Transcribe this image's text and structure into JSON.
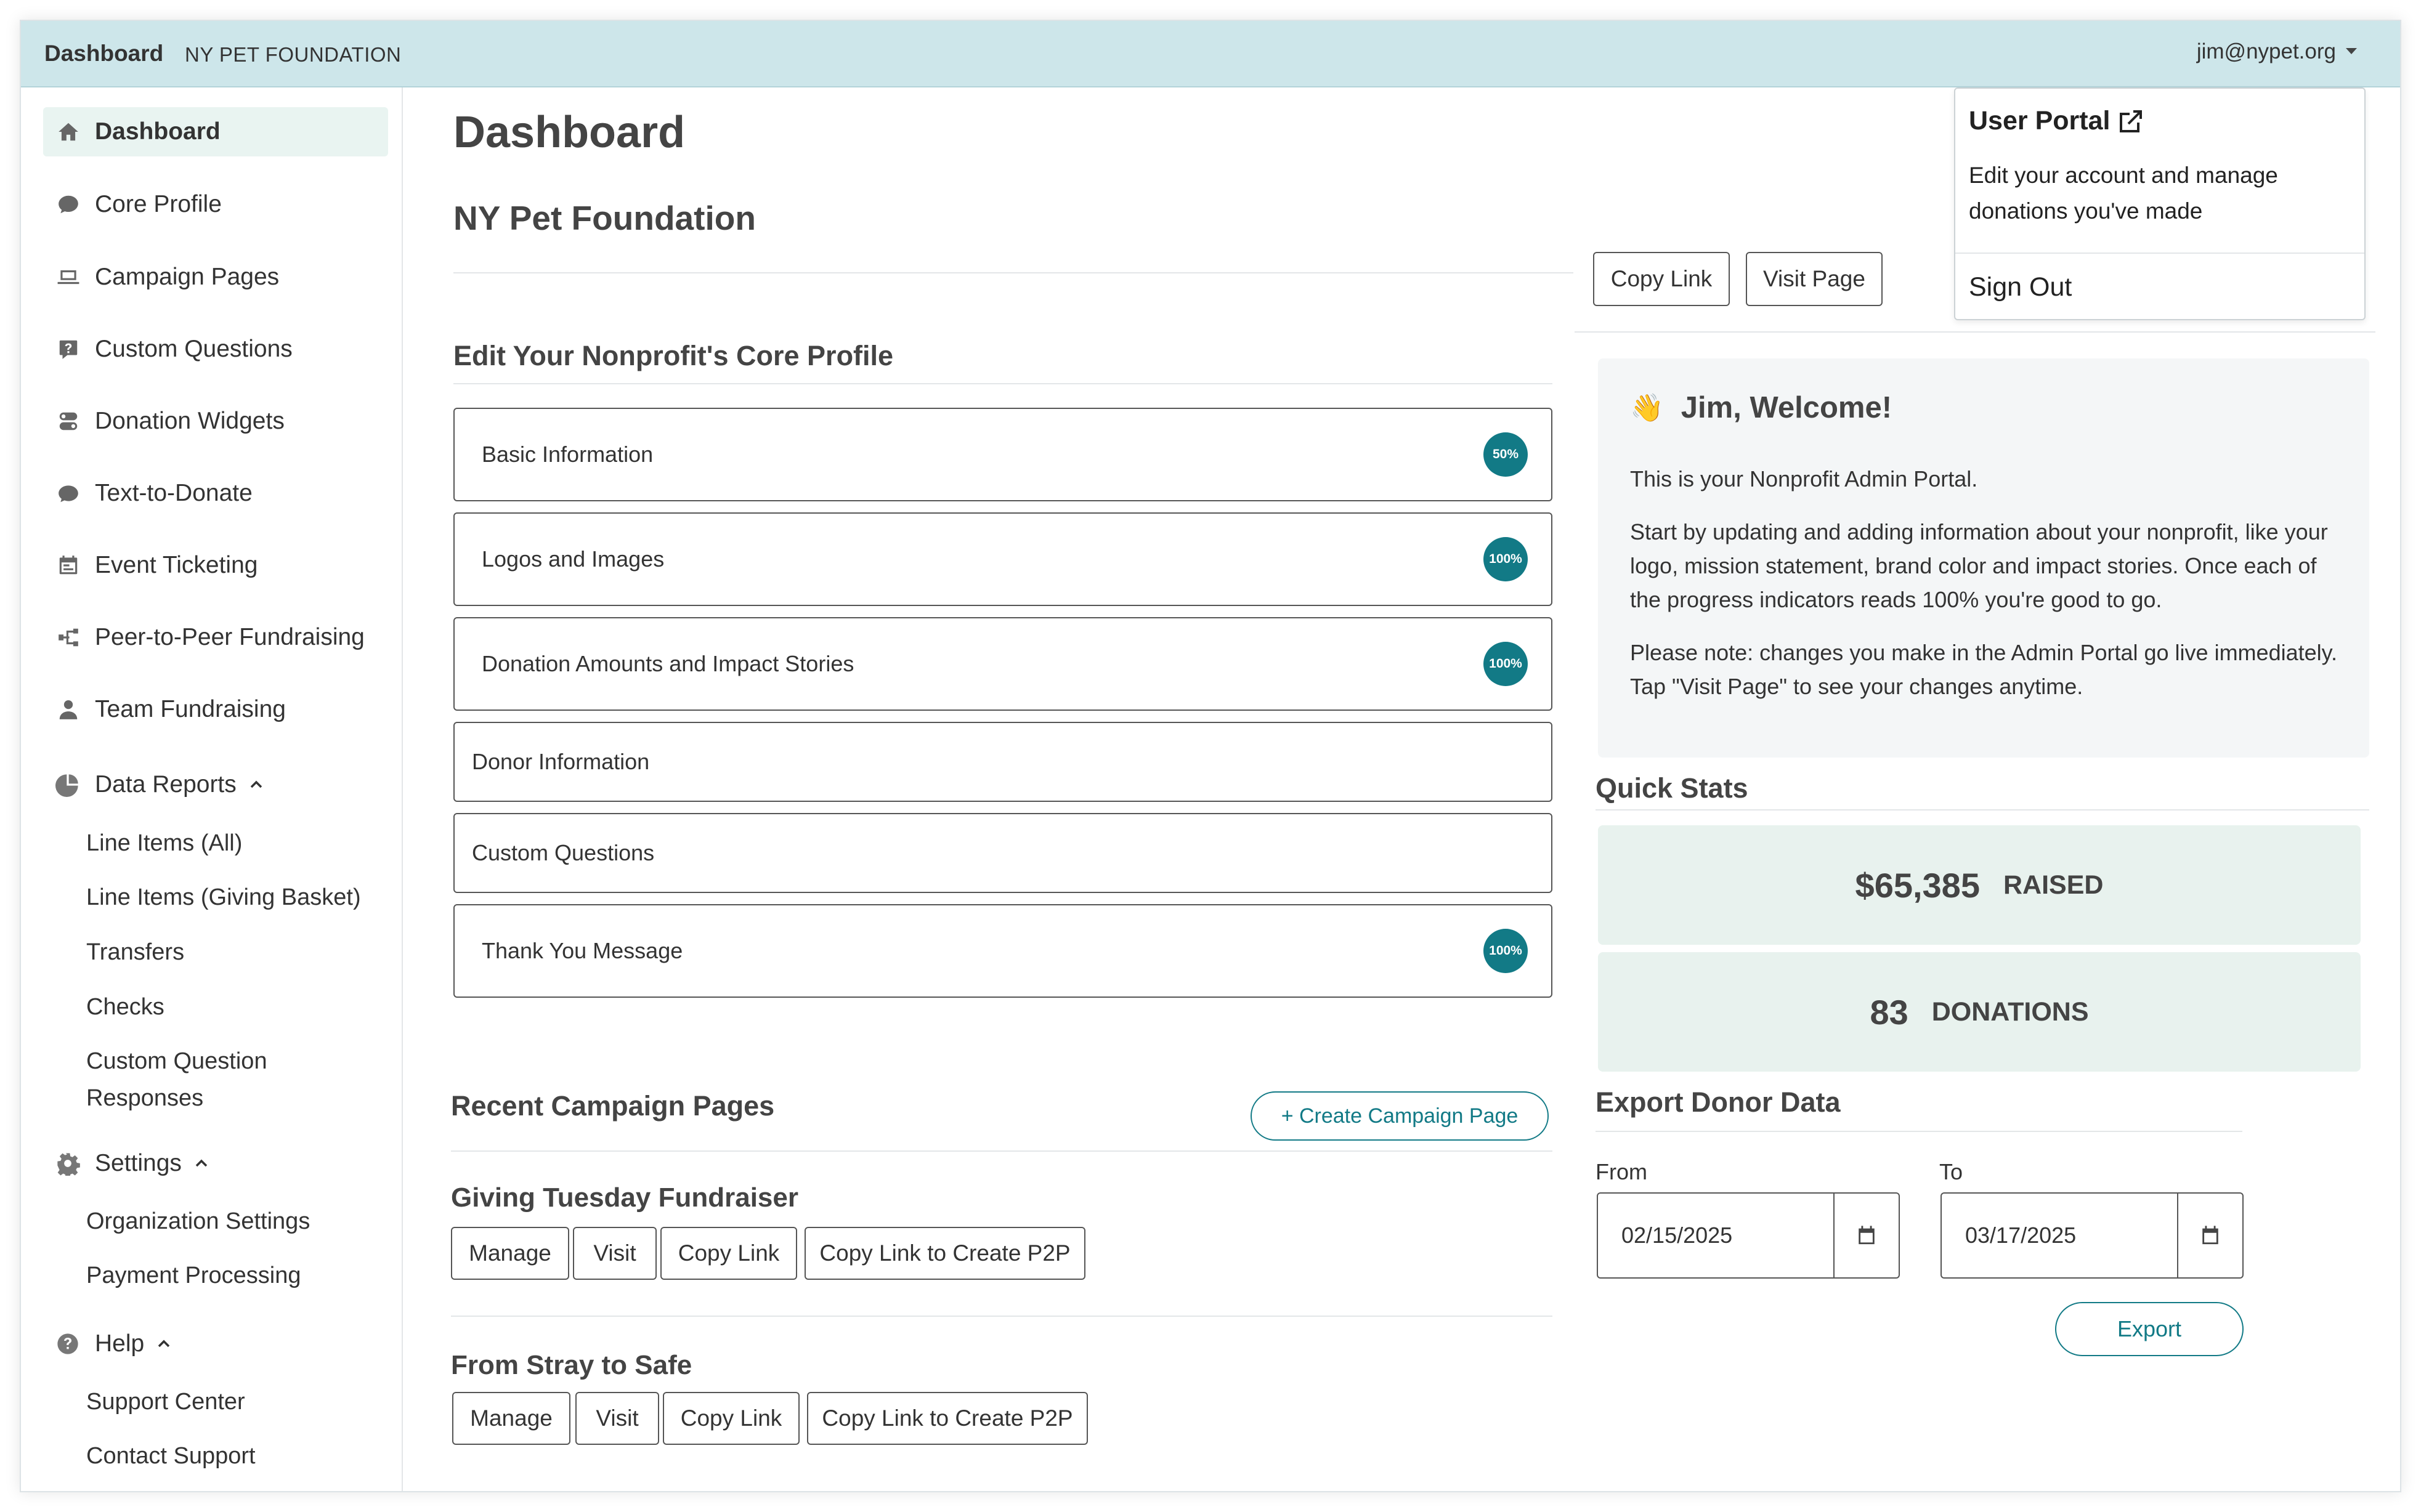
{
  "topbar": {
    "brand": "Dashboard",
    "org": "NY PET FOUNDATION",
    "user": "jim@nypet.org"
  },
  "sidebar": {
    "items": [
      {
        "label": "Dashboard",
        "icon": "home-icon"
      },
      {
        "label": "Core Profile",
        "icon": "chat-bubble-icon"
      },
      {
        "label": "Campaign Pages",
        "icon": "laptop-icon"
      },
      {
        "label": "Custom Questions",
        "icon": "question-square-icon"
      },
      {
        "label": "Donation Widgets",
        "icon": "toggles-icon"
      },
      {
        "label": "Text-to-Donate",
        "icon": "message-icon"
      },
      {
        "label": "Event Ticketing",
        "icon": "calendar-event-icon"
      },
      {
        "label": "Peer-to-Peer Fundraising",
        "icon": "diagram-icon"
      },
      {
        "label": "Team Fundraising",
        "icon": "person-icon"
      }
    ],
    "data_reports": {
      "label": "Data Reports",
      "items": [
        "Line Items (All)",
        "Line Items (Giving Basket)",
        "Transfers",
        "Checks",
        "Custom Question",
        "Responses"
      ]
    },
    "settings": {
      "label": "Settings",
      "items": [
        "Organization Settings",
        "Payment Processing"
      ]
    },
    "help": {
      "label": "Help",
      "items": [
        "Support Center",
        "Contact Support"
      ]
    }
  },
  "main": {
    "title": "Dashboard",
    "org_title": "NY Pet Foundation",
    "copy_link": "Copy Link",
    "visit_page": "Visit Page",
    "core_heading": "Edit Your Nonprofit's Core Profile",
    "core_items": [
      {
        "label": "Basic Information",
        "badge": "50%"
      },
      {
        "label": "Logos and Images",
        "badge": "100%"
      },
      {
        "label": "Donation Amounts and Impact Stories",
        "badge": "100%"
      },
      {
        "label": "Donor Information",
        "badge": ""
      },
      {
        "label": "Custom Questions",
        "badge": ""
      },
      {
        "label": "Thank You Message",
        "badge": "100%"
      }
    ],
    "recent_heading": "Recent Campaign Pages",
    "create_label": "+ Create Campaign Page",
    "campaigns": [
      {
        "title": "Giving Tuesday Fundraiser",
        "actions": [
          "Manage",
          "Visit",
          "Copy Link",
          "Copy Link to Create P2P"
        ]
      },
      {
        "title": "From Stray to Safe",
        "actions": [
          "Manage",
          "Visit",
          "Copy Link",
          "Copy Link to Create P2P"
        ]
      }
    ]
  },
  "dropdown": {
    "title": "User Portal",
    "desc": "Edit your account and manage donations you've made",
    "signout": "Sign Out"
  },
  "welcome": {
    "emoji": "👋",
    "title": "Jim, Welcome!",
    "p1": "This is your Nonprofit Admin Portal.",
    "p2": "Start by updating and adding information about your nonprofit, like your logo, mission statement, brand color and impact stories. Once each of the progress indicators reads 100% you're good to go.",
    "p3": "Please note: changes you make in the Admin Portal go live immediately. Tap \"Visit Page\" to see your changes anytime."
  },
  "quick_stats": {
    "heading": "Quick Stats",
    "raised_value": "$65,385",
    "raised_label": "RAISED",
    "donations_value": "83",
    "donations_label": "DONATIONS"
  },
  "export": {
    "heading": "Export Donor Data",
    "from_label": "From",
    "from_value": "02/15/2025",
    "to_label": "To",
    "to_value": "03/17/2025",
    "button": "Export"
  },
  "colors": {
    "accent": "#127a86",
    "topbar": "#cde6ea",
    "stat_bg": "#e8f2ee",
    "active_nav": "#e9f4f1"
  }
}
